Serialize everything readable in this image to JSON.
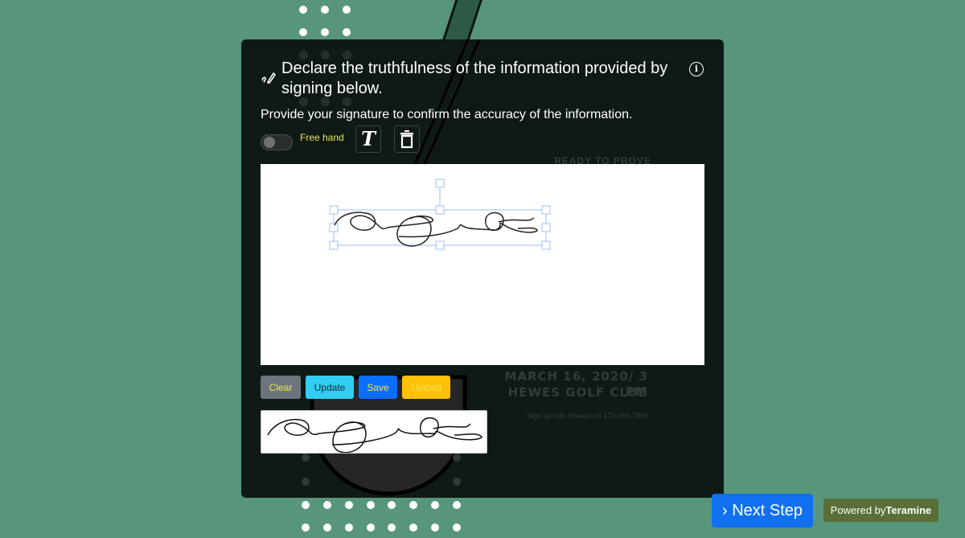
{
  "colors": {
    "page_background": "#57967a",
    "card_background": "#0f1a16",
    "toggle_label": "#e8e44a",
    "clear_button": "#6c757d",
    "update_button": "#33cdf0",
    "save_button": "#0d6efd",
    "upload_button": "#ffc107",
    "next_step_button": "#1170f0",
    "powered_badge": "#5a6e37"
  },
  "header": {
    "icon": "signature-icon",
    "title": "Declare the truthfulness of the information provided by signing below.",
    "info_icon": "info-icon",
    "info_glyph": "i"
  },
  "subtitle": "Provide your signature to confirm the accuracy of the information.",
  "toolbar": {
    "toggle_label": "Free hand",
    "toggle_on": false,
    "text_tool_glyph": "T",
    "text_tool_icon": "text-type-icon",
    "delete_tool_icon": "trash-icon"
  },
  "background_poster": {
    "heading": "READY TO PROVE",
    "event_line1": "MARCH 16, 2020/ 3 PM",
    "event_line2": "HEWES GOLF CLUB",
    "signup": "Sign up with Howard at 123-456-7890"
  },
  "actions": {
    "clear": "Clear",
    "update": "Update",
    "save": "Save",
    "upload": "Upload"
  },
  "footer": {
    "next_step_chevron": "›",
    "next_step": "Next Step",
    "powered_prefix": "Powered by",
    "powered_brand": "Teramine"
  }
}
